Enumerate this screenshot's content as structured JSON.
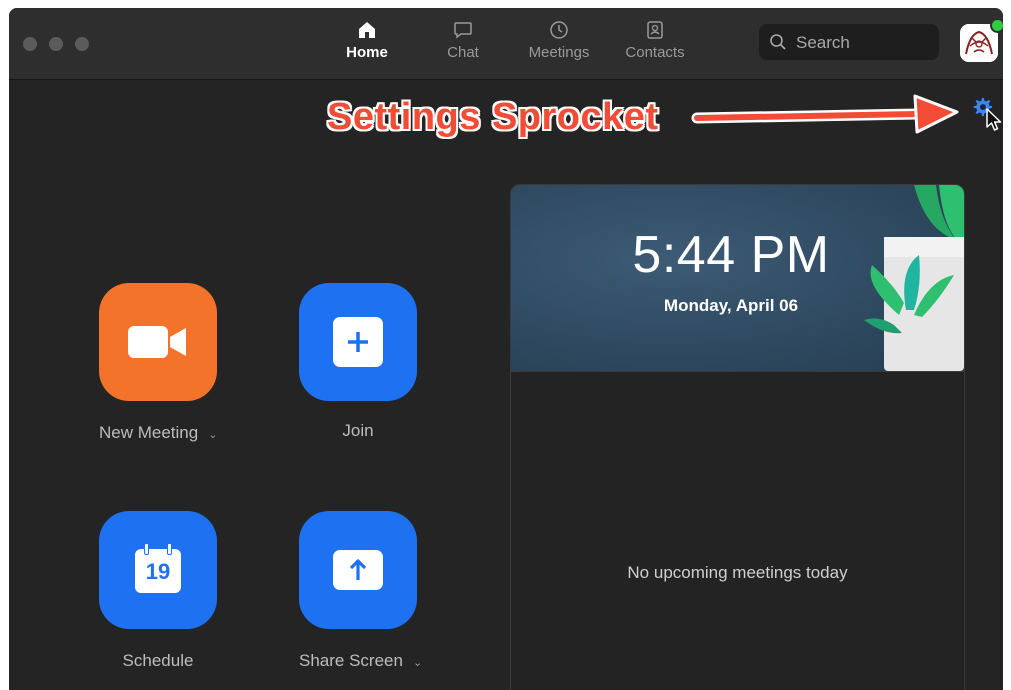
{
  "window": {
    "tabs": [
      {
        "label": "Home",
        "icon": "home-icon",
        "active": true
      },
      {
        "label": "Chat",
        "icon": "chat-icon",
        "active": false
      },
      {
        "label": "Meetings",
        "icon": "clock-icon",
        "active": false
      },
      {
        "label": "Contacts",
        "icon": "contacts-icon",
        "active": false
      }
    ],
    "search": {
      "placeholder": "Search"
    },
    "status_color": "#2ecc40"
  },
  "annotation": {
    "text": "Settings Sprocket",
    "color": "#f24b36"
  },
  "actions": [
    {
      "label": "New Meeting",
      "icon": "video-camera-icon",
      "color": "#f4732b",
      "has_menu": true
    },
    {
      "label": "Join",
      "icon": "plus-icon",
      "color": "#1e72f2",
      "has_menu": false
    },
    {
      "label": "Schedule",
      "icon": "calendar-icon",
      "color": "#1e72f2",
      "calendar_day": "19",
      "has_menu": false
    },
    {
      "label": "Share Screen",
      "icon": "share-up-arrow-icon",
      "color": "#1e72f2",
      "has_menu": true
    }
  ],
  "clock": {
    "time": "5:44 PM",
    "date": "Monday, April 06"
  },
  "meetings": {
    "empty_text": "No upcoming meetings today"
  }
}
